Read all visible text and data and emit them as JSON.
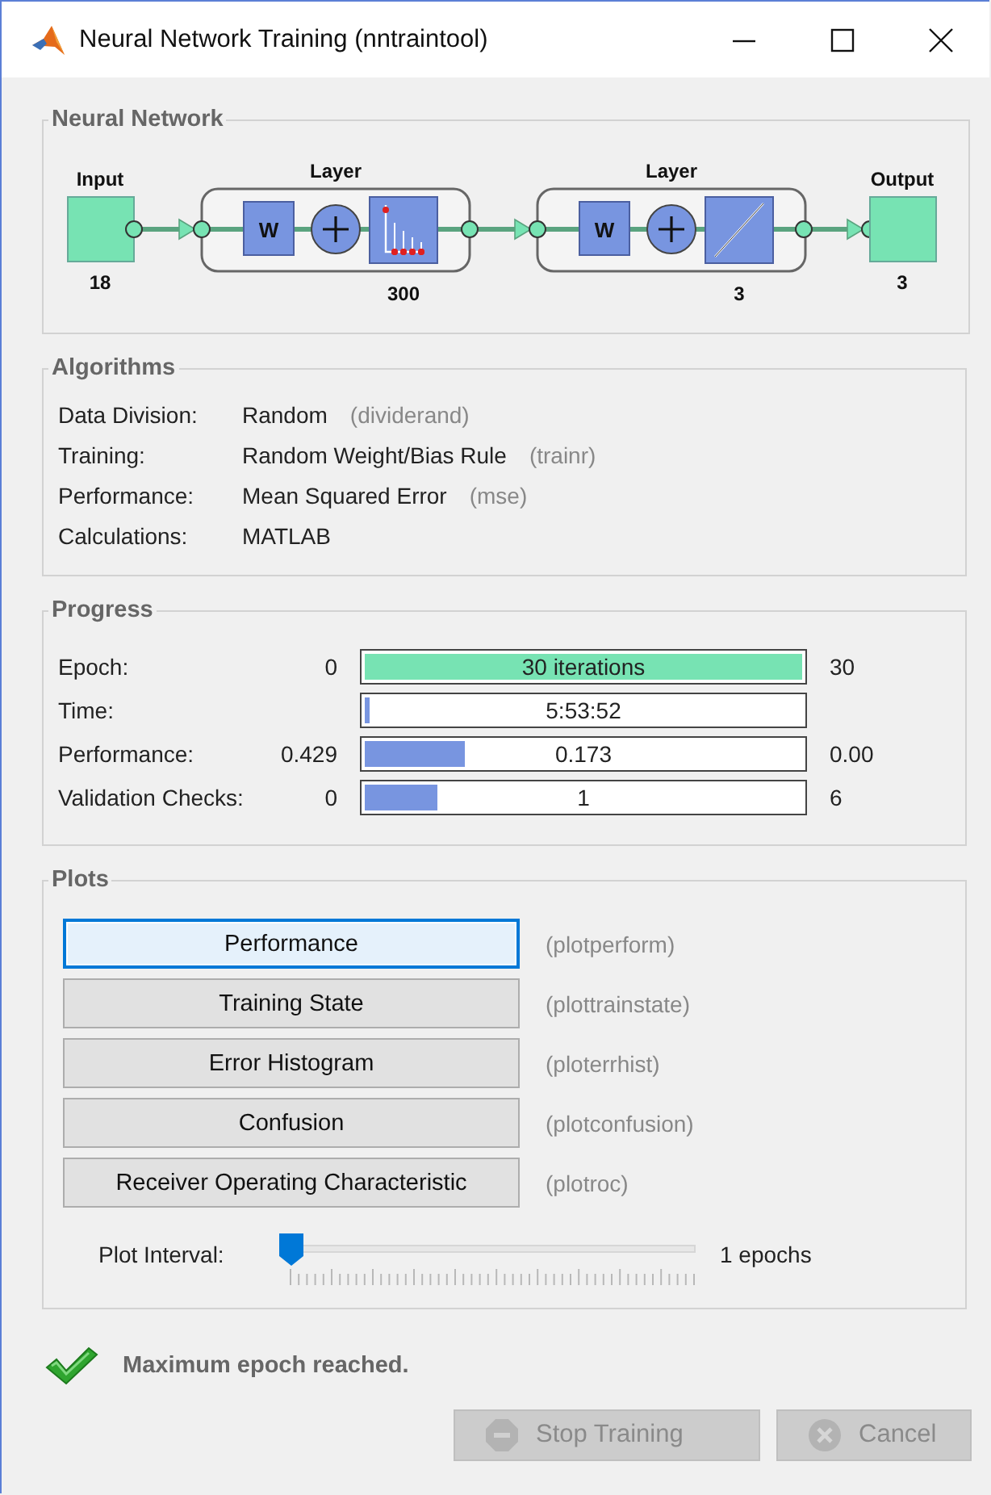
{
  "window": {
    "title": "Neural Network Training (nntraintool)"
  },
  "network": {
    "title": "Neural Network",
    "input": {
      "label": "Input",
      "size": "18"
    },
    "layers": [
      {
        "label": "Layer",
        "weight": "W",
        "size": "300",
        "kind": "stem"
      },
      {
        "label": "Layer",
        "weight": "W",
        "size": "3",
        "kind": "linear"
      }
    ],
    "output": {
      "label": "Output",
      "size": "3"
    }
  },
  "algorithms": {
    "title": "Algorithms",
    "rows": [
      {
        "label": "Data Division:",
        "value": "Random",
        "function": "(dividerand)"
      },
      {
        "label": "Training:",
        "value": "Random Weight/Bias Rule",
        "function": "(trainr)"
      },
      {
        "label": "Performance:",
        "value": "Mean Squared Error",
        "function": "(mse)"
      },
      {
        "label": "Calculations:",
        "value": "MATLAB"
      }
    ]
  },
  "progress": {
    "title": "Progress",
    "rows": [
      {
        "label": "Epoch:",
        "start": "0",
        "bar_text": "30 iterations",
        "end": "30",
        "level": 1,
        "color": "#77e3b3"
      },
      {
        "label": "Time:",
        "bar_text": "5:53:52",
        "level": 0.01,
        "color": "#7895e0"
      },
      {
        "label": "Performance:",
        "start": "0.429",
        "bar_text": "0.173",
        "end": "0.00",
        "level": 0.23,
        "color": "#7895e0"
      },
      {
        "label": "Validation Checks:",
        "start": "0",
        "bar_text": "1",
        "end": "6",
        "level": 0.165,
        "color": "#7895e0"
      }
    ]
  },
  "plots": {
    "title": "Plots",
    "buttons": [
      {
        "label": "Performance",
        "function": "(plotperform)",
        "selected": true
      },
      {
        "label": "Training State",
        "function": "(plottrainstate)",
        "selected": false
      },
      {
        "label": "Error Histogram",
        "function": "(ploterrhist)",
        "selected": false
      },
      {
        "label": "Confusion",
        "function": "(plotconfusion)",
        "selected": false
      },
      {
        "label": "Receiver Operating Characteristic",
        "function": "(plotroc)",
        "selected": false
      }
    ],
    "interval": {
      "label": "Plot Interval:",
      "level": 0,
      "reading": "1 epochs"
    }
  },
  "status": {
    "message": "Maximum epoch reached."
  },
  "buttons": [
    {
      "label": "Stop Training",
      "kind": "stop",
      "disabled": true
    },
    {
      "label": "Cancel",
      "kind": "cancel",
      "disabled": true
    }
  ]
}
